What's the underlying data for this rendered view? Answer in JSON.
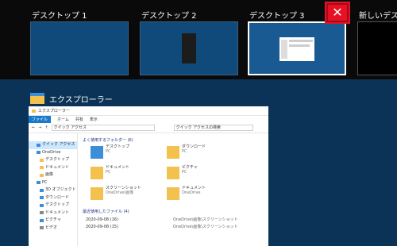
{
  "desktops": [
    {
      "label": "デスクトップ 1"
    },
    {
      "label": "デスクトップ 2"
    },
    {
      "label": "デスクトップ 3"
    },
    {
      "label": "新しいデスクトップ"
    }
  ],
  "close_glyph": "✕",
  "window": {
    "title": "エクスプローラー"
  },
  "explorer": {
    "title_bar": "エクスプローラー",
    "ribbon": [
      "ファイル",
      "ホーム",
      "共有",
      "表示"
    ],
    "address": "クイック アクセス",
    "search_placeholder": "クイック アクセスの検索",
    "nav": [
      "クイック アクセス",
      "OneDrive",
      "デスクトップ",
      "ドキュメント",
      "画像",
      "PC",
      "3D オブジェクト",
      "ダウンロード",
      "デスクトップ",
      "ドキュメント",
      "ピクチャ",
      "ビデオ"
    ],
    "frequent_header": "よく使用するフォルダー (6)",
    "frequent": [
      {
        "name": "デスクトップ",
        "sub": "PC"
      },
      {
        "name": "ダウンロード",
        "sub": "PC"
      },
      {
        "name": "ドキュメント",
        "sub": "PC"
      },
      {
        "name": "ピクチャ",
        "sub": "PC"
      },
      {
        "name": "スクリーンショット",
        "sub": "OneDrive\\画像"
      },
      {
        "name": "ドキュメント",
        "sub": "OneDrive"
      }
    ],
    "recent_header": "最近使用したファイル (4)",
    "recent": [
      {
        "name": "2020-09-08 (16)",
        "path": "OneDrive\\画像\\スクリーンショット"
      },
      {
        "name": "2020-09-08 (15)",
        "path": "OneDrive\\画像\\スクリーンショット"
      }
    ]
  }
}
